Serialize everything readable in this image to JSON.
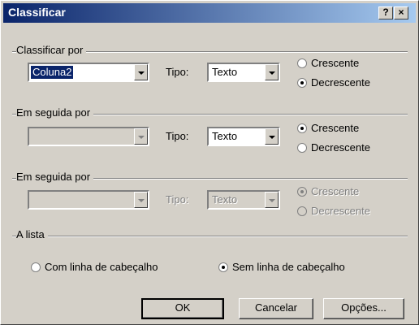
{
  "window": {
    "title": "Classificar",
    "help_label": "?",
    "close_label": "×"
  },
  "sort1": {
    "group_label": "Classificar por",
    "field_value": "Coluna2",
    "type_label": "Tipo:",
    "type_value": "Texto",
    "asc_label": "Crescente",
    "desc_label": "Decrescente",
    "selected": "desc"
  },
  "sort2": {
    "group_label": "Em seguida por",
    "field_value": "",
    "type_label": "Tipo:",
    "type_value": "Texto",
    "asc_label": "Crescente",
    "desc_label": "Decrescente",
    "selected": "asc"
  },
  "sort3": {
    "group_label": "Em seguida por",
    "field_value": "",
    "type_label": "Tipo:",
    "type_value": "Texto",
    "asc_label": "Crescente",
    "desc_label": "Decrescente",
    "selected": "asc",
    "disabled": true
  },
  "list": {
    "group_label": "A lista",
    "with_header_label": "Com linha de cabeçalho",
    "without_header_label": "Sem linha de cabeçalho",
    "selected": "without"
  },
  "buttons": {
    "ok_label": "OK",
    "cancel_label": "Cancelar",
    "options_label": "Opções..."
  }
}
